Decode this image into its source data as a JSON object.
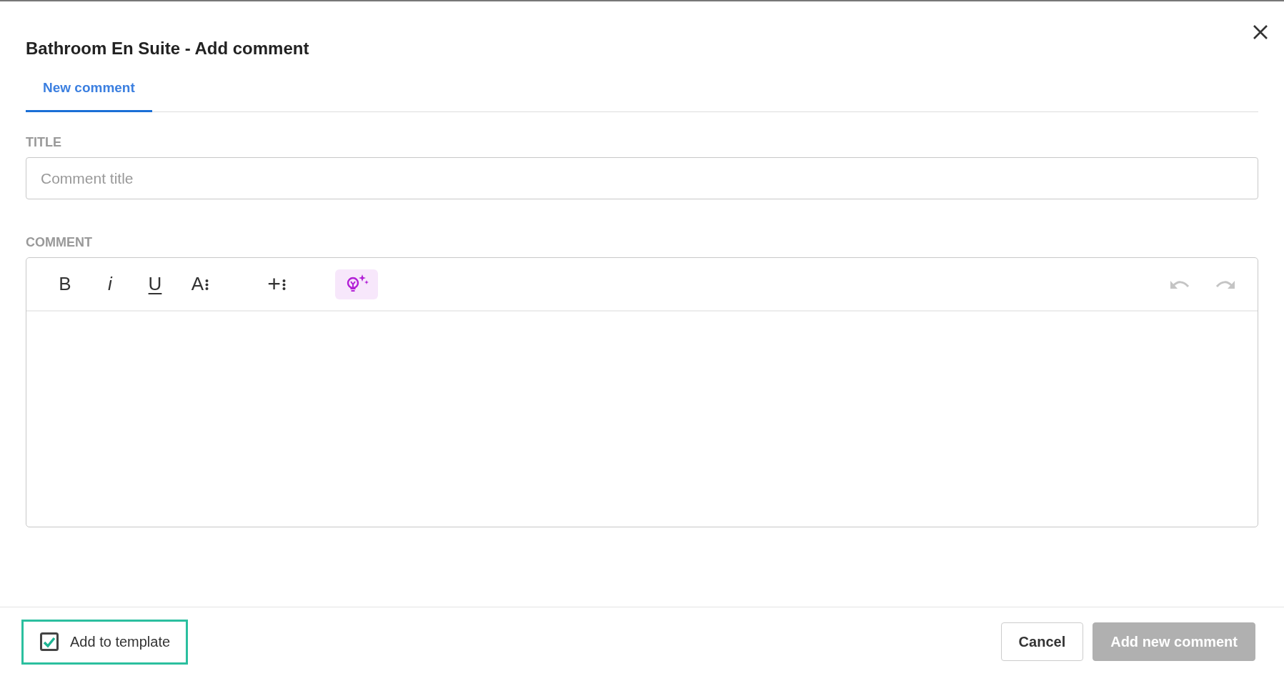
{
  "dialog": {
    "title": "Bathroom En Suite - Add comment"
  },
  "tabs": [
    {
      "label": "New comment",
      "selected": true
    }
  ],
  "title_field": {
    "label": "TITLE",
    "placeholder": "Comment title"
  },
  "comment_field": {
    "label": "COMMENT",
    "toolbar": [
      {
        "kind": "bold",
        "label": "B"
      },
      {
        "kind": "italic",
        "label": "i"
      },
      {
        "kind": "underline",
        "label": "U"
      },
      {
        "kind": "font-menu",
        "label": "A"
      },
      {
        "kind": "insert-menu",
        "label": "+"
      },
      {
        "kind": "ai"
      }
    ],
    "history": [
      {
        "kind": "undo",
        "disabled": true
      },
      {
        "kind": "redo",
        "disabled": true
      }
    ]
  },
  "footer": {
    "checkbox": {
      "label": "Add to template",
      "checked": true
    },
    "buttons": [
      {
        "label": "Cancel",
        "kind": "secondary",
        "disabled": false
      },
      {
        "label": "Add new comment",
        "kind": "primary",
        "disabled": true
      }
    ]
  }
}
